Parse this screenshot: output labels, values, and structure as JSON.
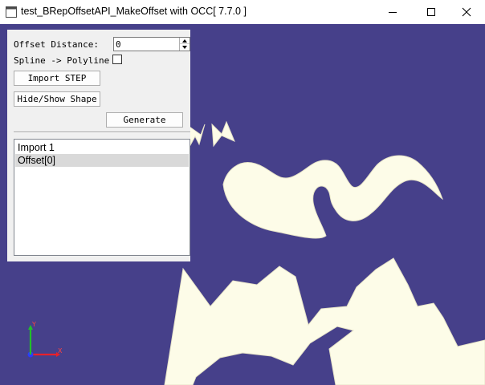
{
  "window": {
    "title": "test_BRepOffsetAPI_MakeOffset with OCC[ 7.7.0 ]",
    "controls": [
      "minimize",
      "maximize",
      "close"
    ]
  },
  "panel": {
    "offset_label": "Offset Distance:",
    "offset_value": "0",
    "spline_label": "Spline -> Polyline",
    "spline_checked": false,
    "import_button": "Import STEP",
    "hide_show_button": "Hide/Show Shape",
    "generate_button": "Generate",
    "list_items": [
      {
        "label": "Import 1",
        "selected": false
      },
      {
        "label": "Offset[0]",
        "selected": true
      }
    ]
  },
  "viewport": {
    "background_color": "#46408a",
    "shape_color": "#fdfce8",
    "axis": {
      "x": "X",
      "y": "Y",
      "x_color": "#e8202a",
      "y_color": "#22c02a",
      "z_color": "#2a3cff"
    }
  }
}
